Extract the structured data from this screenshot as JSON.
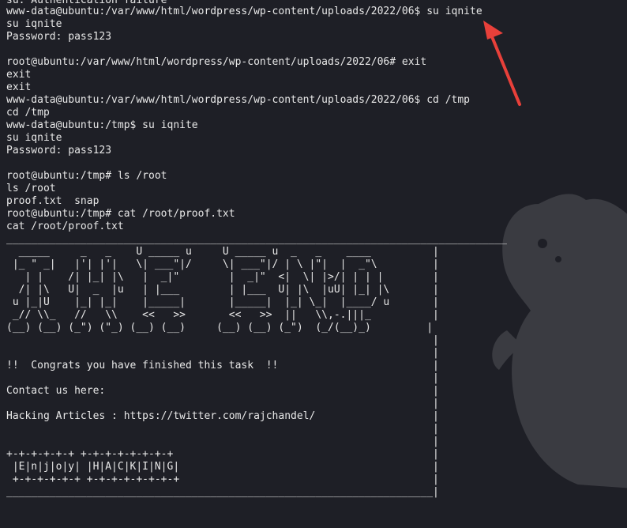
{
  "terminal": {
    "lines": [
      "su: Authentication failure",
      "www-data@ubuntu:/var/www/html/wordpress/wp-content/uploads/2022/06$ su iqnite",
      "su iqnite",
      "Password: pass123",
      "",
      "root@ubuntu:/var/www/html/wordpress/wp-content/uploads/2022/06# exit",
      "exit",
      "exit",
      "www-data@ubuntu:/var/www/html/wordpress/wp-content/uploads/2022/06$ cd /tmp",
      "cd /tmp",
      "www-data@ubuntu:/tmp$ su iqnite",
      "su iqnite",
      "Password: pass123",
      "",
      "root@ubuntu:/tmp# ls /root",
      "ls /root",
      "proof.txt  snap",
      "root@ubuntu:/tmp# cat /root/proof.txt",
      "cat /root/proof.txt",
      "_________________________________________________________________________________",
      "  _____     _   _    U _____ u     U _____ u  _   _    ____          |",
      " |_ \" _|   |'| |'|   \\| ___\"|/     \\| ___\"|/ | \\ |\"|  |  _\"\\         |",
      "   | |    /| |_| |\\   |  _|\"        |  _|\"  <|  \\| |>/| | | |        |",
      "  /| |\\   U|  _  |u   | |___        | |___  U| |\\  |uU| |_| |\\       |",
      " u |_|U    |_| |_|    |_____|       |_____|  |_| \\_|  |____/ u       |",
      " _// \\\\_   //   \\\\    <<   >>       <<   >>  ||   \\\\,-.|||_          |",
      "(__) (__) (_\") (\"_) (__) (__)     (__) (__) (_\")  (_/(__)_)         |",
      "                                                                     |",
      "                                                                     |",
      "!!  Congrats you have finished this task  !!                         |",
      "                                                                     |",
      "Contact us here:                                                     |",
      "                                                                     |",
      "Hacking Articles : https://twitter.com/rajchandel/                   |",
      "                                                                     |",
      "                                                                     |",
      "+-+-+-+-+-+ +-+-+-+-+-+-+-+                                          |",
      " |E|n|j|o|y| |H|A|C|K|I|N|G|                                         |",
      " +-+-+-+-+-+ +-+-+-+-+-+-+-+                                         |",
      "_____________________________________________________________________|"
    ]
  },
  "annotation": {
    "arrow_color": "#e8403a"
  }
}
